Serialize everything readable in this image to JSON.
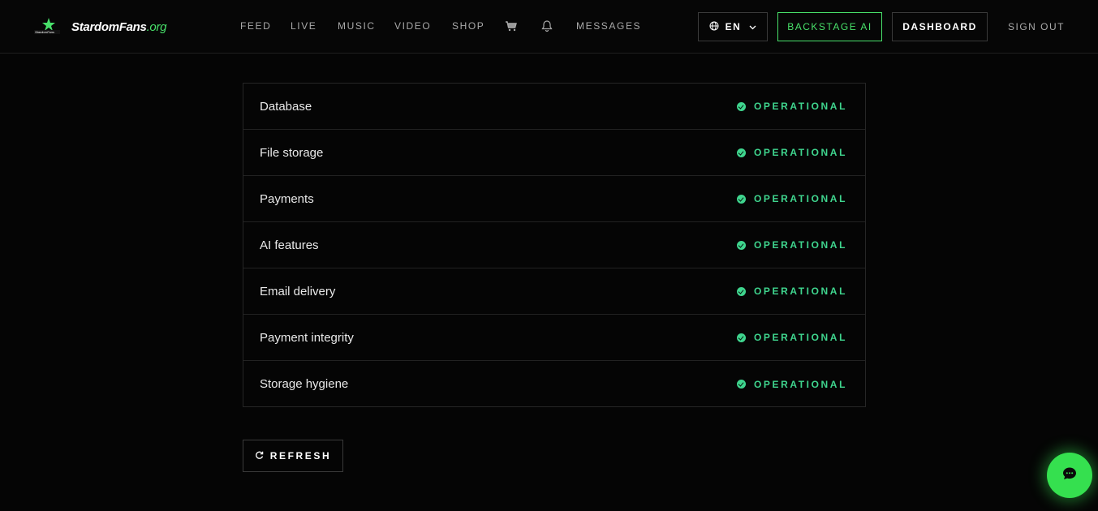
{
  "brand": {
    "name": "StardomFans",
    "tld": ".org"
  },
  "nav": {
    "items": [
      "FEED",
      "LIVE",
      "MUSIC",
      "VIDEO",
      "SHOP"
    ],
    "messages": "MESSAGES",
    "cart_icon": "cart-icon",
    "bell_icon": "bell-icon"
  },
  "header": {
    "language": "EN",
    "backstage_ai": "BACKSTAGE AI",
    "dashboard": "DASHBOARD",
    "sign_out": "SIGN OUT"
  },
  "status": {
    "rows": [
      {
        "name": "Database",
        "state": "OPERATIONAL"
      },
      {
        "name": "File storage",
        "state": "OPERATIONAL"
      },
      {
        "name": "Payments",
        "state": "OPERATIONAL"
      },
      {
        "name": "AI features",
        "state": "OPERATIONAL"
      },
      {
        "name": "Email delivery",
        "state": "OPERATIONAL"
      },
      {
        "name": "Payment integrity",
        "state": "OPERATIONAL"
      },
      {
        "name": "Storage hygiene",
        "state": "OPERATIONAL"
      }
    ]
  },
  "actions": {
    "refresh": "REFRESH"
  },
  "colors": {
    "accent": "#48e06a",
    "operational": "#3fd58e",
    "background": "#050505"
  }
}
